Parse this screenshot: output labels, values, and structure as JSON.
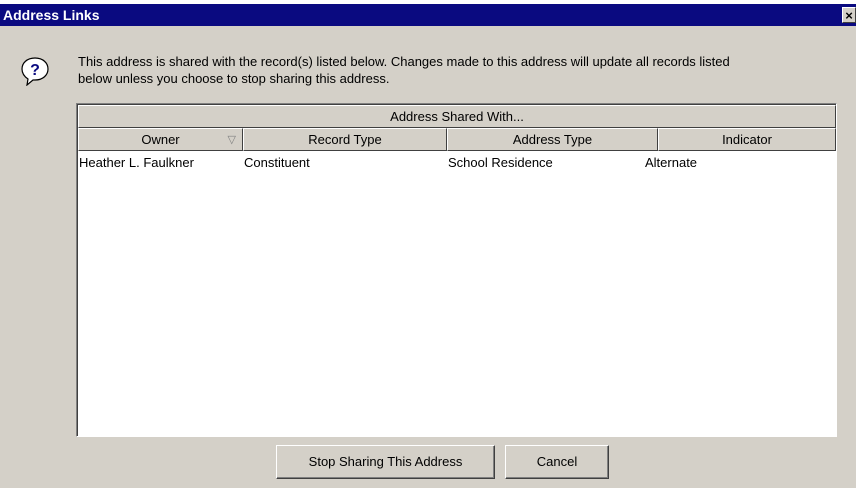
{
  "window": {
    "title": "Address Links",
    "close_glyph": "×"
  },
  "message": {
    "line1": "This address is shared with the record(s) listed below.  Changes made to this address will update all records listed",
    "line2": "below unless you choose to stop sharing this address."
  },
  "grid": {
    "group_header": "Address Shared With...",
    "columns": [
      "Owner",
      "Record Type",
      "Address Type",
      "Indicator"
    ],
    "sort_glyph": "▽",
    "rows": [
      [
        "Heather L. Faulkner",
        "Constituent",
        "School Residence",
        "Alternate"
      ]
    ]
  },
  "buttons": {
    "stop_sharing": "Stop Sharing This Address",
    "cancel": "Cancel"
  },
  "icons": {
    "help": "question-icon",
    "help_glyph": "?",
    "help_color": "#0a0a80"
  }
}
